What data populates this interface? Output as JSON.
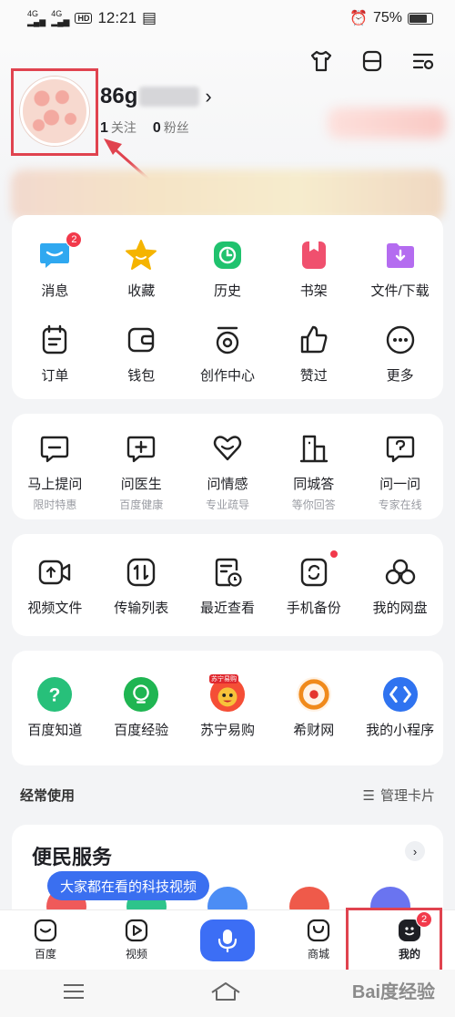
{
  "status_bar": {
    "network_1": "4G",
    "network_2": "4G",
    "hd": "HD",
    "time": "12:21",
    "battery": "75%"
  },
  "profile": {
    "username_visible": "86g",
    "follow_count": "1",
    "follow_label": "关注",
    "fans_count": "0",
    "fans_label": "粉丝"
  },
  "main_grid": [
    {
      "label": "消息",
      "icon": "message-icon",
      "badge": "2"
    },
    {
      "label": "收藏",
      "icon": "star-icon"
    },
    {
      "label": "历史",
      "icon": "clock-icon"
    },
    {
      "label": "书架",
      "icon": "bookshelf-icon"
    },
    {
      "label": "文件/下载",
      "icon": "download-folder-icon"
    },
    {
      "label": "订单",
      "icon": "order-icon"
    },
    {
      "label": "钱包",
      "icon": "wallet-icon"
    },
    {
      "label": "创作中心",
      "icon": "creator-icon"
    },
    {
      "label": "赞过",
      "icon": "thumbs-up-icon"
    },
    {
      "label": "更多",
      "icon": "more-icon"
    }
  ],
  "ask_grid": [
    {
      "label": "马上提问",
      "sub": "限时特惠",
      "icon": "ask-icon"
    },
    {
      "label": "问医生",
      "sub": "百度健康",
      "icon": "doctor-icon"
    },
    {
      "label": "问情感",
      "sub": "专业疏导",
      "icon": "heart-icon"
    },
    {
      "label": "同城答",
      "sub": "等你回答",
      "icon": "building-icon"
    },
    {
      "label": "问一问",
      "sub": "专家在线",
      "icon": "question-icon"
    }
  ],
  "pan_grid": [
    {
      "label": "视频文件",
      "icon": "video-file-icon"
    },
    {
      "label": "传输列表",
      "icon": "transfer-icon"
    },
    {
      "label": "最近查看",
      "icon": "recent-icon"
    },
    {
      "label": "手机备份",
      "icon": "backup-icon"
    },
    {
      "label": "我的网盘",
      "icon": "cloud-disk-icon"
    }
  ],
  "apps_grid": [
    {
      "label": "百度知道",
      "icon": "baidu-zhidao-icon",
      "color": "#27c07a"
    },
    {
      "label": "百度经验",
      "icon": "baidu-jingyan-icon",
      "color": "#1fb552"
    },
    {
      "label": "苏宁易购",
      "icon": "suning-icon",
      "color": "#f54e36",
      "badge_text": "苏宁易购"
    },
    {
      "label": "希财网",
      "icon": "xicai-icon",
      "color": "#f08a1c"
    },
    {
      "label": "我的小程序",
      "icon": "mini-program-icon",
      "color": "#2f73f0"
    }
  ],
  "frequent": {
    "title": "经常使用",
    "manage_label": "管理卡片"
  },
  "service": {
    "title": "便民服务"
  },
  "tooltip": "大家都在看的科技视频",
  "tabbar": [
    {
      "label": "百度",
      "icon": "baidu-home-icon"
    },
    {
      "label": "视频",
      "icon": "video-play-icon"
    },
    {
      "label": "",
      "icon": "mic-icon"
    },
    {
      "label": "商城",
      "icon": "shop-bag-icon"
    },
    {
      "label": "我的",
      "icon": "profile-face-icon",
      "badge": "2"
    }
  ],
  "watermark": "Bai度经验",
  "colors": {
    "accent_blue": "#3c6ef5",
    "badge_red": "#f2394b",
    "highlight_red": "#e0434f"
  }
}
